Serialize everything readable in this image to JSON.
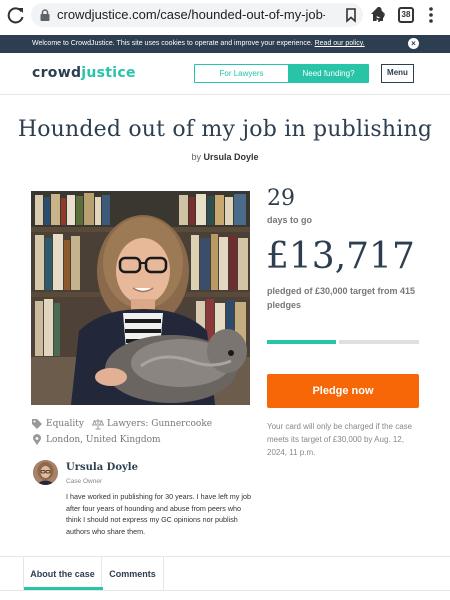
{
  "browser": {
    "url": "crowdjustice.com/case/hounded-out-of-my-job-in-p",
    "tab_count": "38",
    "icons": [
      "reload-icon",
      "lock-icon",
      "bookmark-icon",
      "mic-icon",
      "home-icon",
      "tabs-icon",
      "more-icon"
    ]
  },
  "cookie_banner": {
    "text": "Welcome to CrowdJustice. This site uses cookies to operate and improve your experience.",
    "link": "Read our policy.",
    "close_icon": "close-icon"
  },
  "header": {
    "logo_crowd": "crowd",
    "logo_justice": "justice",
    "for_lawyers": "For Lawyers",
    "need_funding": "Need funding?",
    "menu": "Menu"
  },
  "case": {
    "title": "Hounded out of my job in publishing",
    "by": "by",
    "author": "Ursula Doyle",
    "category": "Equality",
    "lawyers": "Lawyers: Gunnercooke",
    "location": "London, United Kingdom"
  },
  "stats": {
    "days": "29",
    "days_label": "days to go",
    "amount": "£13,717",
    "pledged_text": "pledged of £30,000 target from 415 pledges",
    "progress_fraction": 0.457,
    "pledge_button": "Pledge now",
    "charge_note": "Your card will only be charged if the case meets its target of £30,000 by Aug. 12, 2024, 11 p.m."
  },
  "owner": {
    "name": "Ursula Doyle",
    "role": "Case Owner",
    "description": "I have worked in publishing for 30 years. I have left my job after four years of hounding and abuse from peers who think I should not express my GC opinions nor publish authors who share them."
  },
  "tabs": [
    {
      "label": "About the case",
      "active": true
    },
    {
      "label": "Comments",
      "active": false
    }
  ],
  "colors": {
    "brand_teal": "#27c4a8",
    "navy": "#2c3e50",
    "pledge_orange": "#f76707"
  }
}
